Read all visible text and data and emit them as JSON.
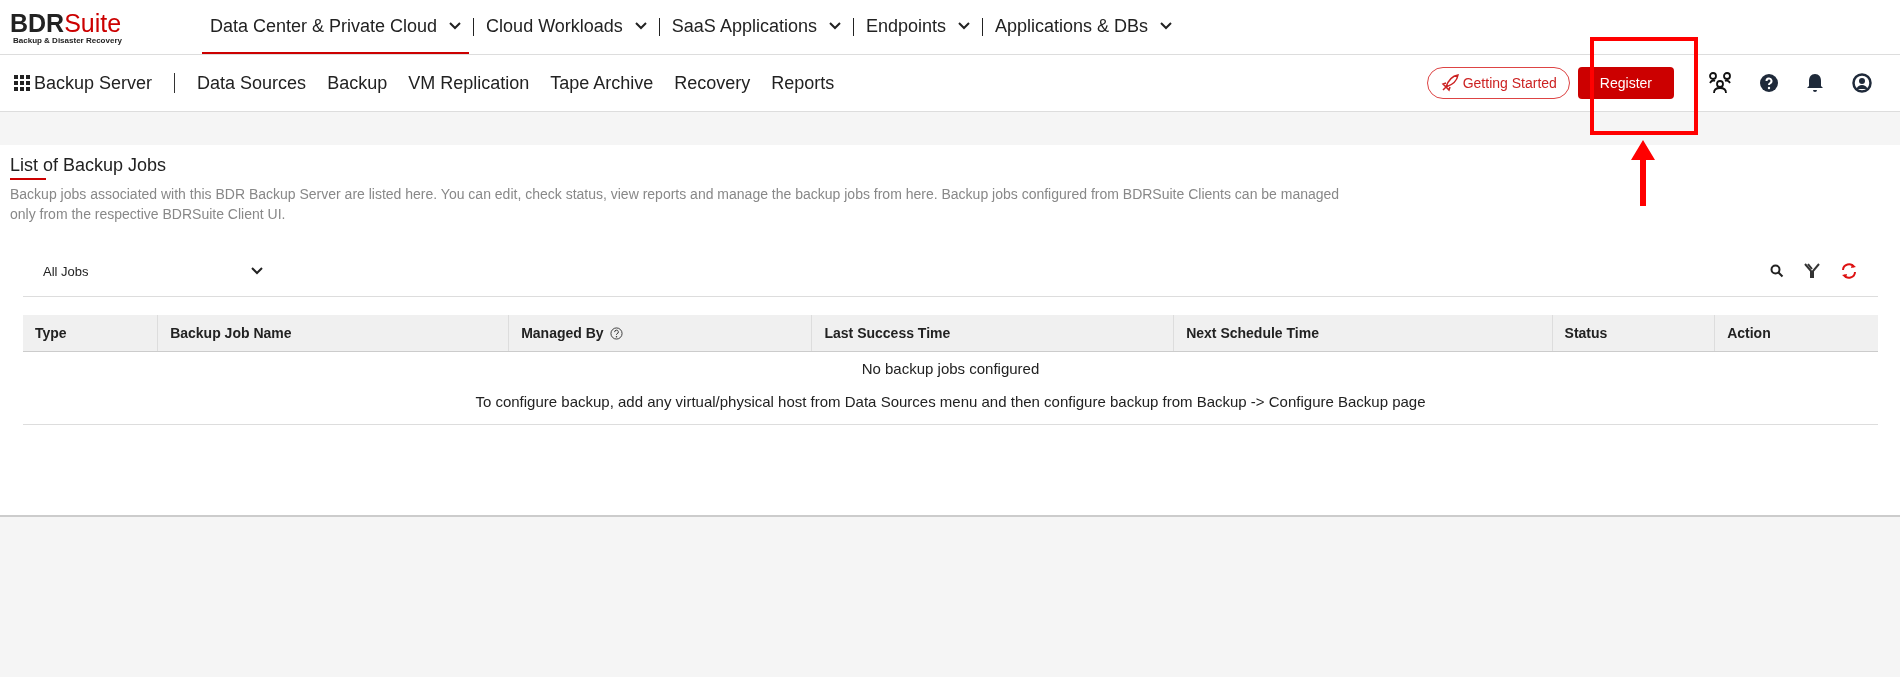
{
  "logo": {
    "name": "BDR",
    "name_accent": "Suite",
    "tagline": "Backup & Disaster Recovery"
  },
  "top_nav": [
    {
      "label": "Data Center & Private Cloud",
      "selected": true
    },
    {
      "label": "Cloud Workloads",
      "selected": false
    },
    {
      "label": "SaaS Applications",
      "selected": false
    },
    {
      "label": "Endpoints",
      "selected": false
    },
    {
      "label": "Applications & DBs",
      "selected": false
    }
  ],
  "sub_nav": {
    "title": "Backup Server",
    "items": [
      "Data Sources",
      "Backup",
      "VM Replication",
      "Tape Archive",
      "Recovery",
      "Reports"
    ]
  },
  "getting_started": "Getting Started",
  "register": "Register",
  "page": {
    "title": "List of Backup Jobs",
    "description": "Backup jobs associated with this BDR Backup Server are listed here. You can edit, check status, view reports and manage the backup jobs from here. Backup jobs configured from BDRSuite Clients can be managed only from the respective BDRSuite Client UI."
  },
  "filter": {
    "value": "All Jobs"
  },
  "table": {
    "columns": [
      "Type",
      "Backup Job Name",
      "Managed By",
      "Last Success Time",
      "Next Schedule Time",
      "Status",
      "Action"
    ],
    "empty_title": "No backup jobs configured",
    "empty_hint": "To configure backup, add any virtual/physical host from Data Sources menu and then configure backup from Backup -> Configure Backup page"
  }
}
